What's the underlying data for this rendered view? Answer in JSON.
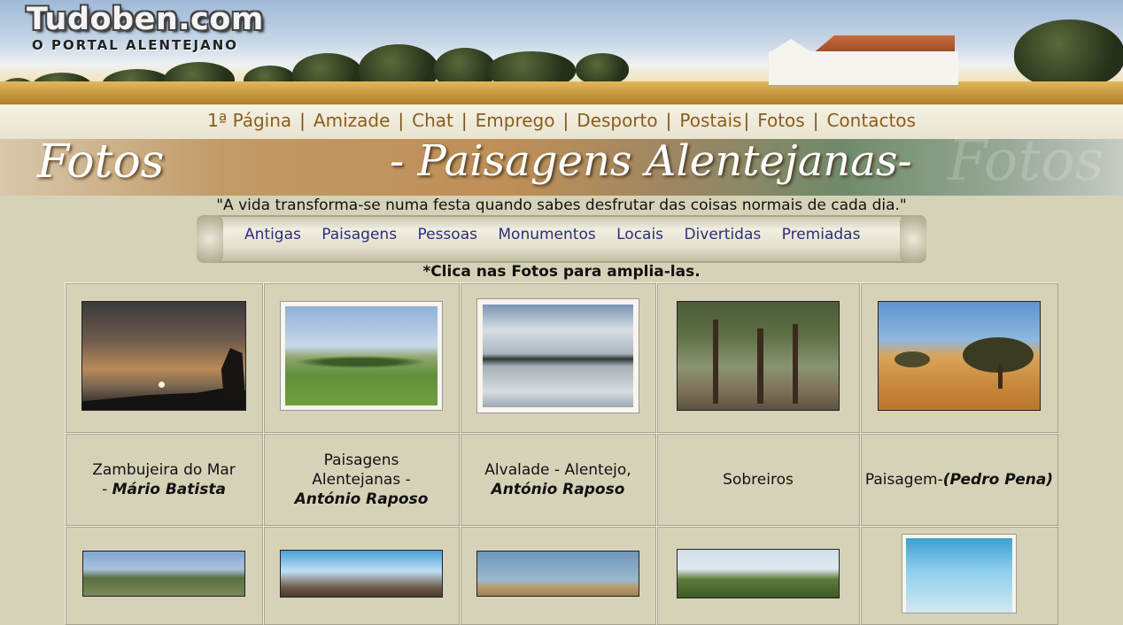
{
  "site": {
    "logo": "Tudoben.com",
    "tagline": "O PORTAL ALENTEJANO"
  },
  "topnav": {
    "items": [
      "1ª Página",
      "Amizade",
      "Chat",
      "Emprego",
      "Desporto",
      "Postais",
      "Fotos",
      "Contactos"
    ],
    "separator": "|"
  },
  "banner": {
    "left": "Fotos",
    "right": "- Paisagens Alentejanas-"
  },
  "quote": "\"A vida transforma-se numa festa quando sabes desfrutar das coisas normais de cada dia.\"",
  "subnav": {
    "items": [
      "Antigas",
      "Paisagens",
      "Pessoas",
      "Monumentos",
      "Locais",
      "Divertidas",
      "Premiadas"
    ]
  },
  "instructions": "*Clica nas Fotos para amplia-las.",
  "photos": [
    {
      "title": "Zambujeira do Mar",
      "sep": " - ",
      "author": "Mário Batista",
      "image": "sunset-sea-cliff"
    },
    {
      "title": "Paisagens Alentejanas -",
      "sep": " ",
      "author": "António Raposo",
      "image": "green-hills-olive-trees"
    },
    {
      "title": "Alvalade - Alentejo,",
      "sep": " ",
      "author": "António Raposo",
      "image": "lake-reflection-clouds"
    },
    {
      "title": "Sobreiros",
      "sep": "",
      "author": "",
      "image": "cork-oak-forest"
    },
    {
      "title": "Paisagem-",
      "sep": "",
      "author": "(Pedro Pena)",
      "image": "golden-plain-tree"
    }
  ],
  "photos_row2": [
    "hillside-village",
    "sky-clouds-rock",
    "dry-field-horizon",
    "trees-under-sky",
    "blue-sky-branch"
  ],
  "colors": {
    "page_bg": "#d6d2b8",
    "nav_link": "#8a5d1d",
    "subnav_link": "#2c2f78"
  }
}
